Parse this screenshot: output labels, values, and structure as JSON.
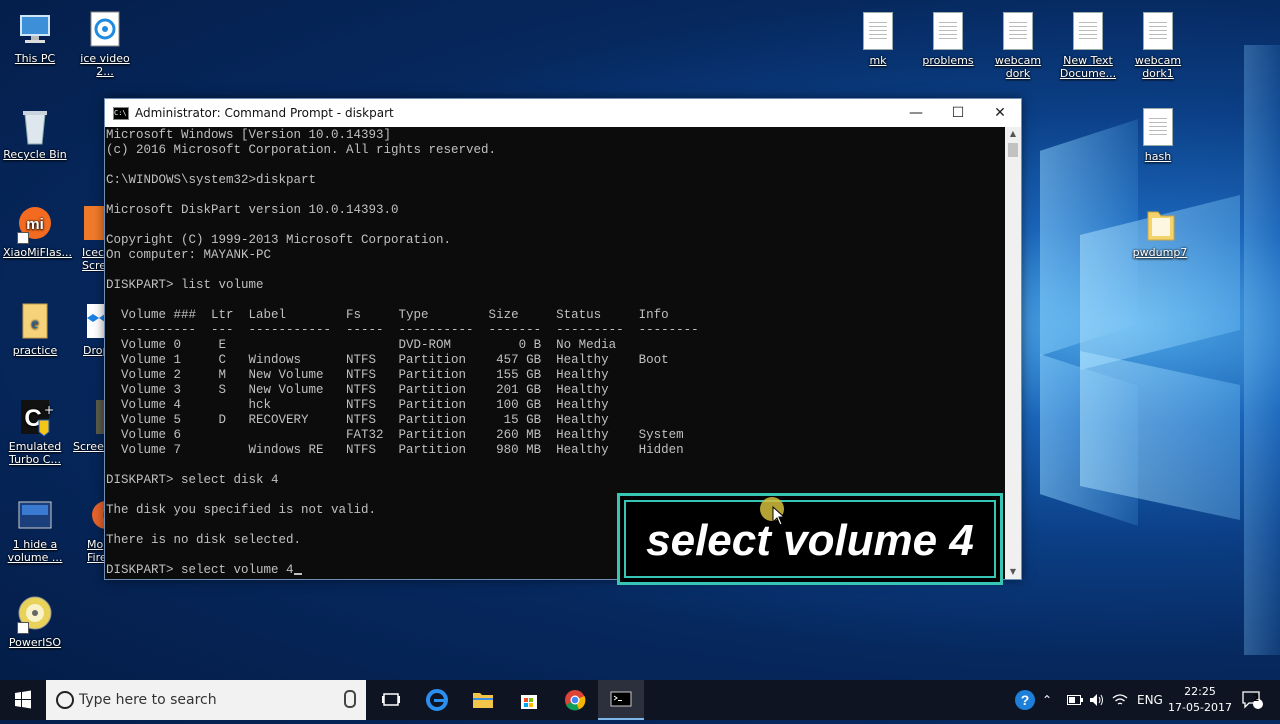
{
  "desktop": {
    "left_icons": [
      {
        "label": "This PC",
        "icon": "computer-icon"
      },
      {
        "label": "ice video 2...",
        "icon": "video-app-icon"
      },
      {
        "label": "Recycle Bin",
        "icon": "recycle-bin-icon"
      },
      {
        "label": "XiaoMiFlas...",
        "icon": "xiaomi-icon"
      },
      {
        "label": "Icec\nScre",
        "icon": "icecream-icon"
      },
      {
        "label": "practice",
        "icon": "document-icon"
      },
      {
        "label": "Drop",
        "icon": "dropbox-icon"
      },
      {
        "label": "Emulated\nTurbo C...",
        "icon": "turbo-c-icon"
      },
      {
        "label": "Screen",
        "icon": "screen-app-icon"
      },
      {
        "label": "1 hide a\nvolume ...",
        "icon": "video-thumbnail-icon"
      },
      {
        "label": "Mo\nFire",
        "icon": "firefox-icon"
      },
      {
        "label": "PowerISO",
        "icon": "disc-icon"
      }
    ],
    "right_icons": [
      {
        "label": "mk",
        "icon": "text-file-icon"
      },
      {
        "label": "problems",
        "icon": "text-file-icon"
      },
      {
        "label": "webcam\ndork",
        "icon": "text-file-icon"
      },
      {
        "label": "New Text\nDocume...",
        "icon": "text-file-icon"
      },
      {
        "label": "webcam\ndork1",
        "icon": "text-file-icon"
      },
      {
        "label": "hash",
        "icon": "text-file-icon"
      },
      {
        "label": "pwdump7",
        "icon": "folder-icon"
      }
    ]
  },
  "window": {
    "title": "Administrator: Command Prompt - diskpart",
    "console_lines": [
      "Microsoft Windows [Version 10.0.14393]",
      "(c) 2016 Microsoft Corporation. All rights reserved.",
      "",
      "C:\\WINDOWS\\system32>diskpart",
      "",
      "Microsoft DiskPart version 10.0.14393.0",
      "",
      "Copyright (C) 1999-2013 Microsoft Corporation.",
      "On computer: MAYANK-PC",
      "",
      "DISKPART> list volume",
      "",
      "  Volume ###  Ltr  Label        Fs     Type        Size     Status     Info",
      "  ----------  ---  -----------  -----  ----------  -------  ---------  --------",
      "  Volume 0     E                       DVD-ROM         0 B  No Media",
      "  Volume 1     C   Windows      NTFS   Partition    457 GB  Healthy    Boot",
      "  Volume 2     M   New Volume   NTFS   Partition    155 GB  Healthy",
      "  Volume 3     S   New Volume   NTFS   Partition    201 GB  Healthy",
      "  Volume 4         hck          NTFS   Partition    100 GB  Healthy",
      "  Volume 5     D   RECOVERY     NTFS   Partition     15 GB  Healthy",
      "  Volume 6                      FAT32  Partition    260 MB  Healthy    System",
      "  Volume 7         Windows RE   NTFS   Partition    980 MB  Healthy    Hidden",
      "",
      "DISKPART> select disk 4",
      "",
      "The disk you specified is not valid.",
      "",
      "There is no disk selected.",
      ""
    ],
    "prompt_line": "DISKPART> select volume 4"
  },
  "overlay": {
    "caption": "select volume 4"
  },
  "taskbar": {
    "search_placeholder": "Type here to search",
    "language": "ENG",
    "time": "22:25",
    "date": "17-05-2017",
    "notification_count": "2"
  },
  "colors": {
    "accent_teal": "#37c6b4",
    "console_bg": "#0c0c0c",
    "console_fg": "#c0c0c0"
  }
}
